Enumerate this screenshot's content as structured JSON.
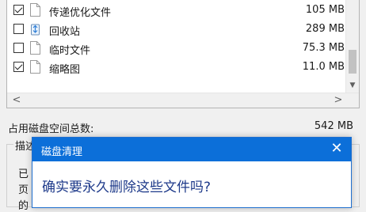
{
  "file_list": {
    "items": [
      {
        "name": "传递优化文件",
        "size": "105 MB",
        "checked": true,
        "icon": "document-icon"
      },
      {
        "name": "回收站",
        "size": "289 MB",
        "checked": false,
        "icon": "recycle-bin-icon"
      },
      {
        "name": "临时文件",
        "size": "75.3 MB",
        "checked": false,
        "icon": "document-icon"
      },
      {
        "name": "缩略图",
        "size": "11.0 MB",
        "checked": true,
        "icon": "document-icon"
      }
    ]
  },
  "total": {
    "label": "占用磁盘空间总数:",
    "value": "542 MB"
  },
  "description": {
    "caption": "描述",
    "lines": [
      "已",
      "页",
      "的"
    ]
  },
  "dialog": {
    "title": "磁盘清理",
    "close_glyph": "✕",
    "message": "确实要永久删除这些文件吗?"
  },
  "scroll_glyphs": {
    "left": "<",
    "right": ">",
    "down": "▼"
  },
  "colors": {
    "dialog_titlebar": "#0c6fd9",
    "dialog_message": "#1e3a8a",
    "recycle_bin": "#2f7fd8"
  }
}
